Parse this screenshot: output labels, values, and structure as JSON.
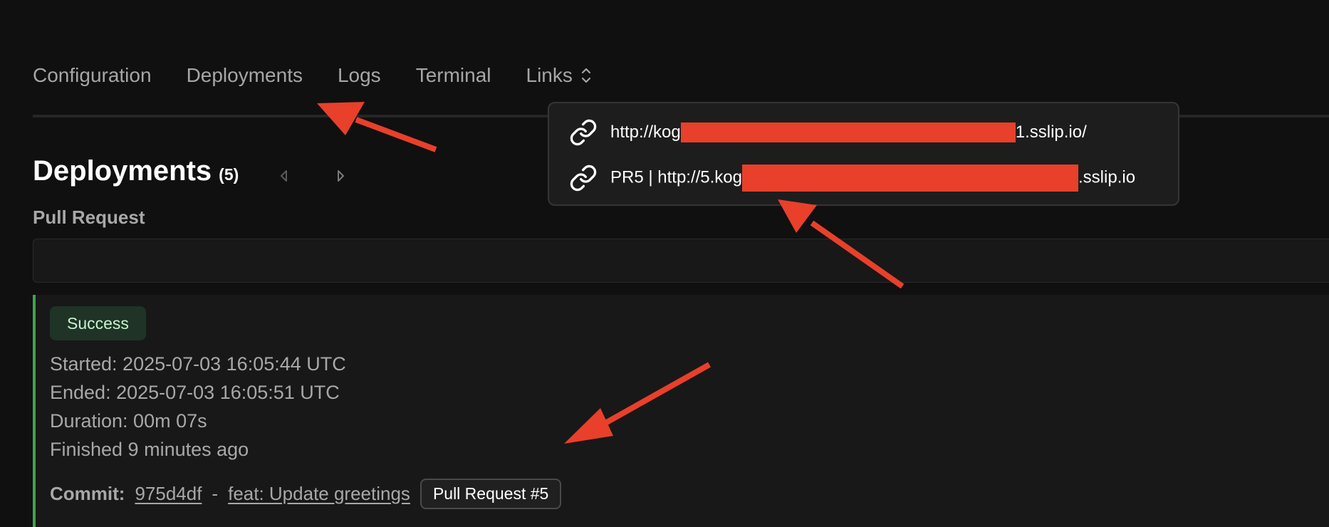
{
  "tabs": [
    {
      "label": "Configuration"
    },
    {
      "label": "Deployments"
    },
    {
      "label": "Logs"
    },
    {
      "label": "Terminal"
    },
    {
      "label": "Links",
      "icon": "chevron-up-down-icon"
    }
  ],
  "heading": {
    "title": "Deployments",
    "count": "(5)"
  },
  "pull_request": {
    "label": "Pull Request",
    "value": ""
  },
  "deployment": {
    "status": "Success",
    "started": "Started: 2025-07-03 16:05:44 UTC",
    "ended": "Ended: 2025-07-03 16:05:51 UTC",
    "duration": "Duration: 00m 07s",
    "finished": "Finished 9 minutes ago",
    "commit_label": "Commit:",
    "commit_hash": "975d4df",
    "commit_sep": "-",
    "commit_message": "feat: Update greetings",
    "pr_badge": "Pull Request #5"
  },
  "links_dropdown": {
    "items": [
      {
        "prefix": "http://kog",
        "suffix": "1.sslip.io/",
        "icon": "link-icon"
      },
      {
        "prefix": "PR5 | http://5.kog",
        "suffix": ".sslip.io",
        "icon": "link-icon"
      }
    ]
  },
  "colors": {
    "background": "#101010",
    "success_border": "#3fa34d",
    "success_badge_bg": "#1f3326",
    "redaction": "#e8402a",
    "annotation_arrow": "#e8402a"
  }
}
